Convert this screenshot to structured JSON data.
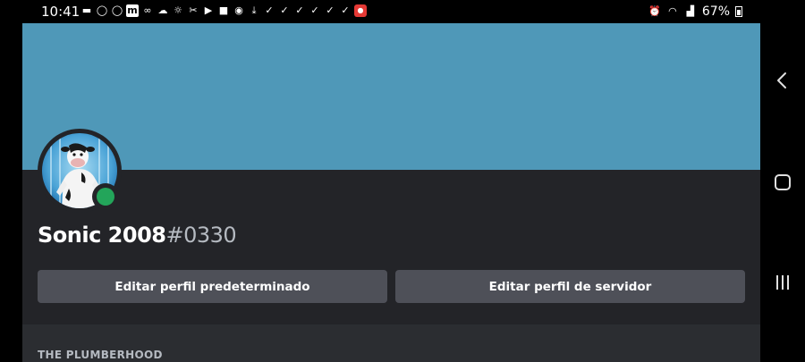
{
  "status_bar": {
    "time": "10:41",
    "battery": "67%",
    "notification_icons": [
      "message-icon",
      "whatsapp-icon",
      "whatsapp-icon",
      "m-icon",
      "voicemail-icon",
      "cloud-icon",
      "weather-icon",
      "scissors-icon",
      "youtube-icon",
      "video-icon",
      "messenger-icon",
      "download-icon",
      "check-icon",
      "check-icon",
      "check-icon",
      "check-icon",
      "check-icon",
      "check-icon",
      "app-red-icon"
    ],
    "system_icons": [
      "alarm-icon",
      "wifi-icon",
      "signal-icon"
    ]
  },
  "profile": {
    "banner_color": "#4f98b8",
    "username": "Sonic 2008",
    "discriminator": "#0330",
    "status_color": "#23a55a"
  },
  "buttons": {
    "edit_default": "Editar perfil predeterminado",
    "edit_server": "Editar perfil de servidor"
  },
  "section": {
    "title": "THE PLUMBERHOOD"
  }
}
